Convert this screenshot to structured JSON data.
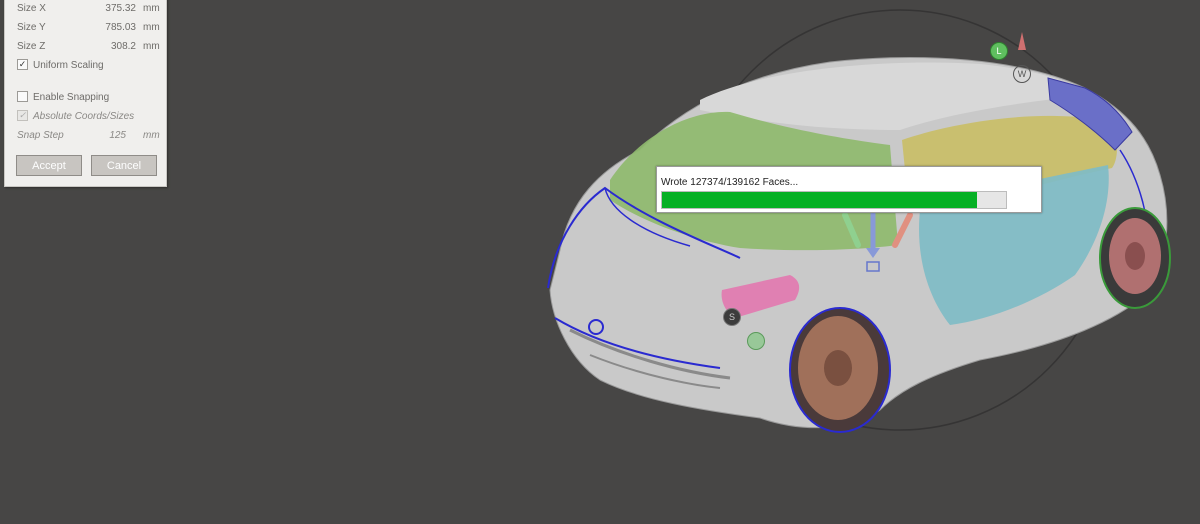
{
  "transform_panel": {
    "size_x_label": "Size X",
    "size_x_value": "375.32",
    "size_x_unit": "mm",
    "size_y_label": "Size Y",
    "size_y_value": "785.03",
    "size_y_unit": "mm",
    "size_z_label": "Size Z",
    "size_z_value": "308.2",
    "size_z_unit": "mm",
    "uniform_scaling_label": "Uniform Scaling",
    "uniform_scaling_checked": true,
    "enable_snapping_label": "Enable Snapping",
    "enable_snapping_checked": false,
    "absolute_coords_label": "Absolute Coords/Sizes",
    "absolute_coords_checked": true,
    "snap_step_label": "Snap Step",
    "snap_step_value": "125",
    "snap_step_unit": "mm",
    "accept_label": "Accept",
    "cancel_label": "Cancel"
  },
  "progress_dialog": {
    "message": "Wrote 127374/139162 Faces...",
    "fraction": 0.915
  },
  "gizmo": {
    "handle_l": "L",
    "handle_w": "W",
    "handle_s": "S"
  },
  "colors": {
    "viewport_bg": "#474645",
    "progress_fill": "#06b025"
  }
}
